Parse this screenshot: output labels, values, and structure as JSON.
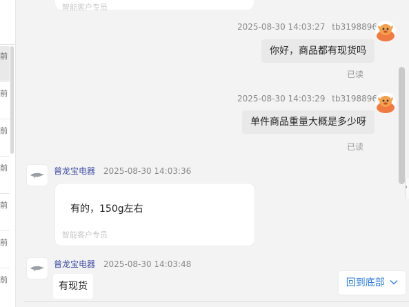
{
  "left_list": {
    "items": [
      "前",
      "前",
      "前",
      "前",
      "前",
      "前",
      "前"
    ]
  },
  "top_card": {
    "tag": "智能客户专员"
  },
  "messages": [
    {
      "side": "right",
      "time": "2025-08-30 14:03:27",
      "user": "tb319889632",
      "text": "你好，商品都有现货吗",
      "status": "已读"
    },
    {
      "side": "right",
      "time": "2025-08-30 14:03:29",
      "user": "tb319889632",
      "text": "单件商品重量大概是多少呀",
      "status": "已读"
    },
    {
      "side": "left",
      "name": "普龙宝电器",
      "time": "2025-08-30 14:03:36",
      "text": "有的，150g左右",
      "tag": "智能客户专员"
    },
    {
      "side": "left",
      "name": "普龙宝电器",
      "time": "2025-08-30 14:03:48",
      "text": "有现货"
    }
  ],
  "back_to_bottom": "回到底部",
  "colors": {
    "link": "#2a7de1",
    "shop_name": "#3b4aa1",
    "right_bubble": "#e9e9e9"
  }
}
